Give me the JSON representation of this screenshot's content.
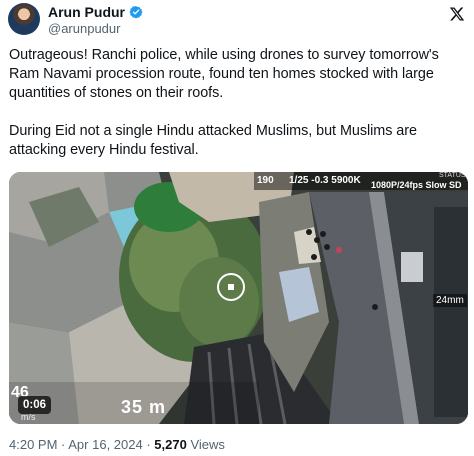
{
  "author": {
    "display_name": "Arun Pudur",
    "handle": "@arunpudur",
    "verified_color": "#1d9bf0"
  },
  "icons": {
    "platform_logo": "x-logo-icon",
    "verified": "verified-badge-icon"
  },
  "tweet": {
    "text": "Outrageous! Ranchi police, while using drones to survey tomorrow's Ram Navami procession route, found ten homes stocked with large quantities of stones on their roofs.\n\nDuring Eid not a single Hindu attacked Muslims, but Muslims are attacking every Hindu festival."
  },
  "video": {
    "timer": "0:06",
    "osd": {
      "top_left": "190",
      "top_middle": "1/25 -0.3 5900K",
      "top_right": "1080P/24fps Slow SD",
      "status": "STATUS",
      "right_value": "24mm",
      "bottom_distance": "35 m",
      "bottom_sub": "m/s",
      "bottom_left_code": "46"
    }
  },
  "meta": {
    "time": "4:20 PM",
    "separator": " · ",
    "date": "Apr 16, 2024",
    "views_count": "5,270",
    "views_label": "Views"
  }
}
